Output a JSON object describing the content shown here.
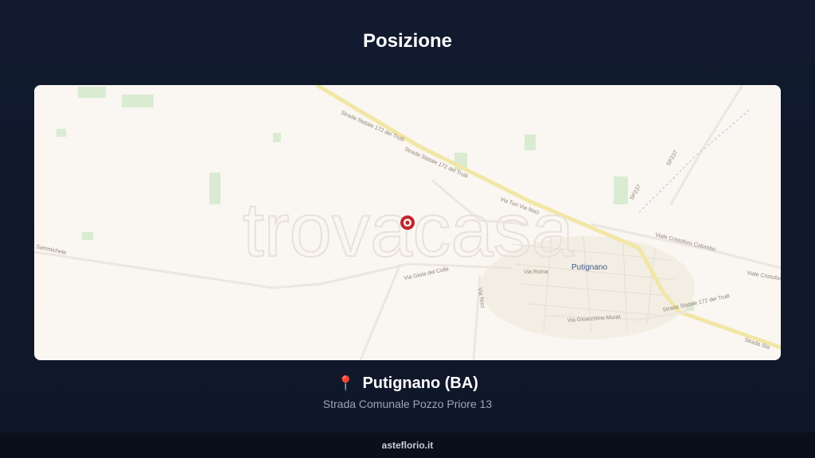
{
  "header": {
    "title": "Posizione"
  },
  "map": {
    "watermark": "trovacasa",
    "town_label": "Putignano",
    "road_labels": {
      "ss172_a": "Strada Statale 172 dei Trulli",
      "ss172_b": "Strada Statale 172 dei Trulli",
      "ss172_c": "Strada Statale 172 dei Trulli",
      "via_turi": "Via Turi Via Noci",
      "via_gioia": "Via Gioia del Colle",
      "via_roma": "Via Roma",
      "viale_colombo": "Viale Cristoforo Colombo",
      "viale_colombo_2": "Viale Cristoforo",
      "via_gioacchino": "Via Gioacchino Murat",
      "via_noci": "Via Noci",
      "sp237": "SP237",
      "sp237_b": "SP237",
      "sammichele": "Sammichele",
      "strada_sta": "Strada Sta"
    },
    "marker_color": "#c0262d"
  },
  "location": {
    "pin_icon": "📍",
    "city": "Putignano (BA)",
    "address": "Strada Comunale Pozzo Priore 13"
  },
  "footer": {
    "brand": "asteflorio.it"
  }
}
